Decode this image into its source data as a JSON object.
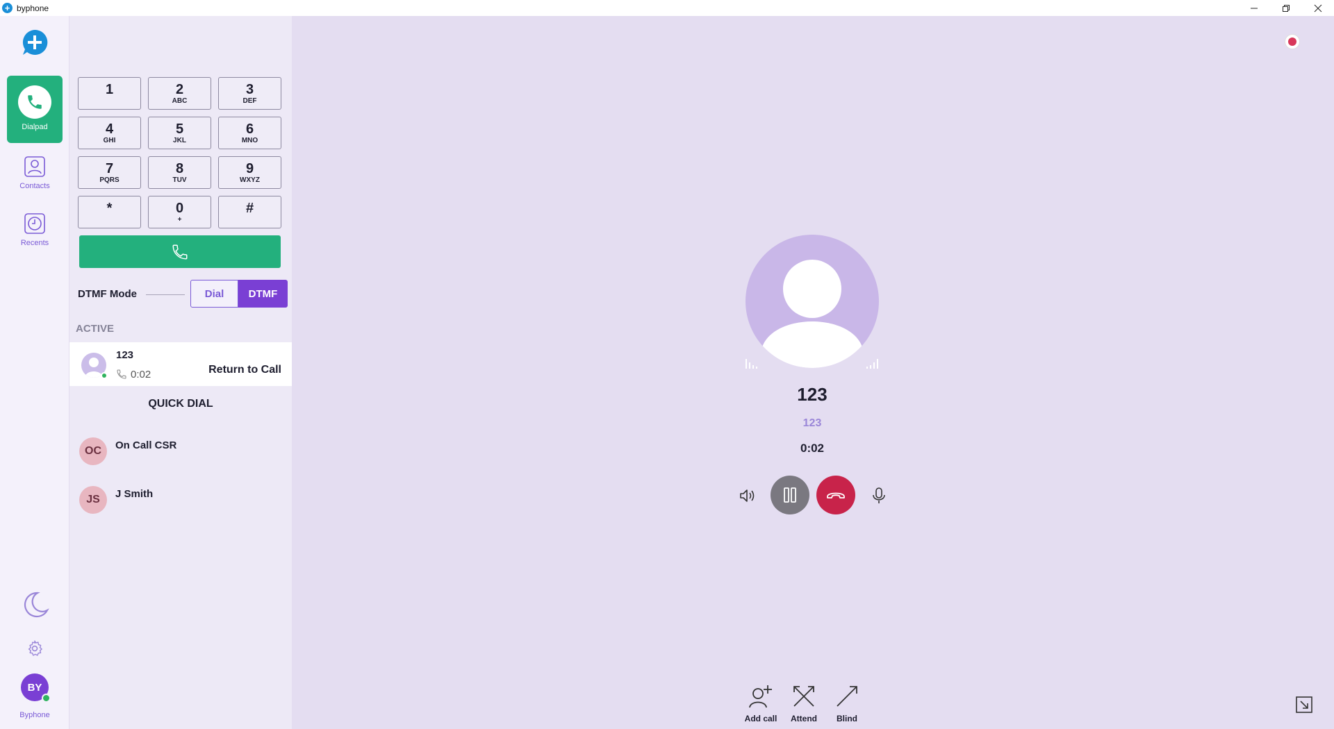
{
  "window": {
    "title": "byphone"
  },
  "nav": {
    "items": [
      {
        "label": "Dialpad",
        "icon": "phone-icon",
        "active": true
      },
      {
        "label": "Contacts",
        "icon": "contact-icon",
        "active": false
      },
      {
        "label": "Recents",
        "icon": "clock-icon",
        "active": false
      }
    ],
    "user": {
      "initials": "BY",
      "name": "Byphone",
      "status": "online"
    }
  },
  "dialpad": {
    "keys": [
      {
        "num": "1",
        "sub": ""
      },
      {
        "num": "2",
        "sub": "ABC"
      },
      {
        "num": "3",
        "sub": "DEF"
      },
      {
        "num": "4",
        "sub": "GHI"
      },
      {
        "num": "5",
        "sub": "JKL"
      },
      {
        "num": "6",
        "sub": "MNO"
      },
      {
        "num": "7",
        "sub": "PQRS"
      },
      {
        "num": "8",
        "sub": "TUV"
      },
      {
        "num": "9",
        "sub": "WXYZ"
      },
      {
        "num": "*",
        "sub": ""
      },
      {
        "num": "0",
        "sub": "+"
      },
      {
        "num": "#",
        "sub": ""
      }
    ],
    "dtmf_mode_label": "DTMF Mode",
    "mode_options": [
      "Dial",
      "DTMF"
    ],
    "selected_mode": "DTMF"
  },
  "active": {
    "section_label": "ACTIVE",
    "call": {
      "name": "123",
      "duration": "0:02",
      "action_label": "Return to Call"
    }
  },
  "quick_dial": {
    "title": "QUICK DIAL",
    "items": [
      {
        "initials": "OC",
        "name": "On Call CSR"
      },
      {
        "initials": "JS",
        "name": "J Smith"
      }
    ]
  },
  "call": {
    "name": "123",
    "number": "123",
    "timer": "0:02",
    "transfer_actions": [
      {
        "label": "Add call",
        "icon": "add-user-icon"
      },
      {
        "label": "Attend",
        "icon": "attended-transfer-icon"
      },
      {
        "label": "Blind",
        "icon": "blind-transfer-icon"
      }
    ]
  },
  "colors": {
    "accent_green": "#23b07d",
    "accent_purple": "#7a3fd4",
    "hangup_red": "#c8234a",
    "hold_gray": "#7a7880",
    "record_red": "#d8385a"
  }
}
